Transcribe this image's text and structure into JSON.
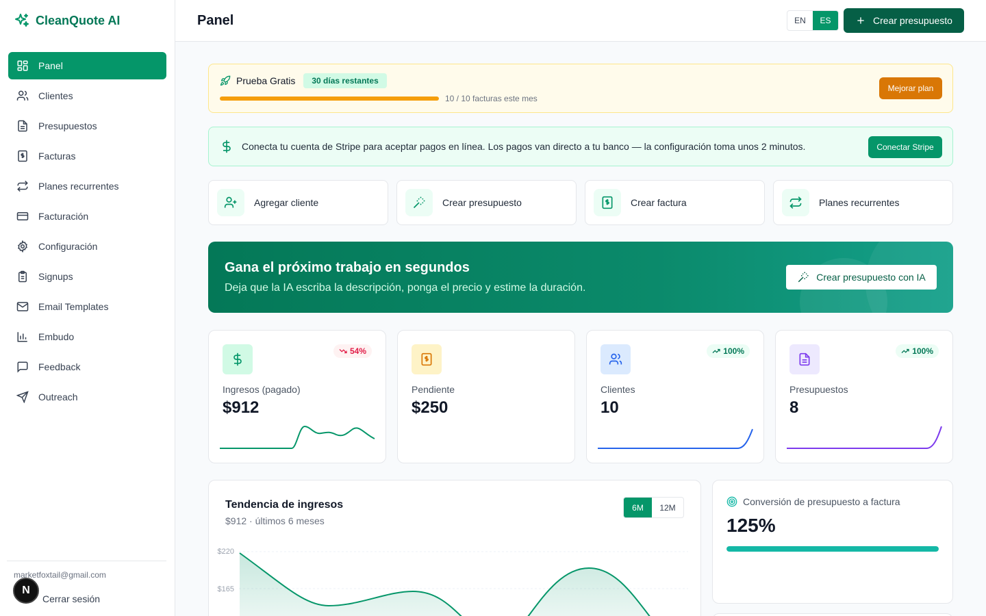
{
  "brand": {
    "name": "CleanQuote AI"
  },
  "sidebar": {
    "items": [
      {
        "label": "Panel",
        "icon": "dashboard-icon",
        "active": true
      },
      {
        "label": "Clientes",
        "icon": "users-icon"
      },
      {
        "label": "Presupuestos",
        "icon": "document-icon"
      },
      {
        "label": "Facturas",
        "icon": "invoice-icon"
      },
      {
        "label": "Planes recurrentes",
        "icon": "repeat-icon"
      },
      {
        "label": "Facturación",
        "icon": "credit-card-icon"
      },
      {
        "label": "Configuración",
        "icon": "gear-icon"
      },
      {
        "label": "Signups",
        "icon": "clipboard-icon"
      },
      {
        "label": "Email Templates",
        "icon": "mail-icon"
      },
      {
        "label": "Embudo",
        "icon": "bar-chart-icon"
      },
      {
        "label": "Feedback",
        "icon": "message-icon"
      },
      {
        "label": "Outreach",
        "icon": "send-icon"
      }
    ],
    "user_email": "marketfoxtail@gmail.com",
    "logout_label": "Cerrar sesión",
    "avatar_letter": "N"
  },
  "header": {
    "title": "Panel",
    "lang_en": "EN",
    "lang_es": "ES",
    "active_lang": "ES",
    "create_label": "Crear presupuesto"
  },
  "trial": {
    "title": "Prueba Gratis",
    "badge": "30 días restantes",
    "usage": "10 / 10 facturas este mes",
    "usage_fraction": 1.0,
    "upgrade_label": "Mejorar plan"
  },
  "stripe": {
    "message": "Conecta tu cuenta de Stripe para aceptar pagos en línea. Los pagos van directo a tu banco — la configuración toma unos 2 minutos.",
    "button_label": "Conectar Stripe"
  },
  "quick_actions": [
    {
      "label": "Agregar cliente",
      "icon": "user-plus-icon"
    },
    {
      "label": "Crear presupuesto",
      "icon": "magic-wand-icon"
    },
    {
      "label": "Crear factura",
      "icon": "invoice-icon"
    },
    {
      "label": "Planes recurrentes",
      "icon": "repeat-icon"
    }
  ],
  "ai_banner": {
    "title": "Gana el próximo trabajo en segundos",
    "subtitle": "Deja que la IA escriba la descripción, ponga el precio y estime la duración.",
    "button_label": "Crear presupuesto con IA"
  },
  "stats": [
    {
      "label": "Ingresos (pagado)",
      "value": "$912",
      "trend": "54%",
      "trend_dir": "down",
      "icon": "dollar-icon",
      "color": "#059669"
    },
    {
      "label": "Pendiente",
      "value": "$250",
      "trend": "",
      "icon": "invoice-icon",
      "color": "#d97706"
    },
    {
      "label": "Clientes",
      "value": "10",
      "trend": "100%",
      "trend_dir": "up",
      "icon": "users-icon",
      "color": "#2563eb"
    },
    {
      "label": "Presupuestos",
      "value": "8",
      "trend": "100%",
      "trend_dir": "up",
      "icon": "document-icon",
      "color": "#7c3aed"
    }
  ],
  "revenue_trend": {
    "title": "Tendencia de ingresos",
    "subtitle": "$912 · últimos 6 meses",
    "range_6m": "6M",
    "range_12m": "12M",
    "active_range": "6M",
    "y_ticks": [
      "$220",
      "$165"
    ]
  },
  "conversion": {
    "label": "Conversión de presupuesto a factura",
    "value": "125%",
    "fill_fraction": 1.0
  },
  "colors": {
    "primary": "#059669",
    "primary_dark": "#065f46",
    "amber": "#d97706",
    "teal": "#14b8a6"
  }
}
